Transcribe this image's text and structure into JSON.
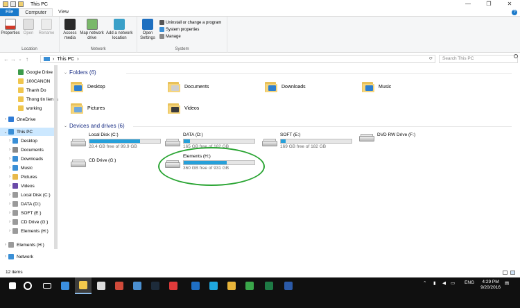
{
  "window": {
    "title": "This PC",
    "minimize": "—",
    "maximize": "❐",
    "close": "✕"
  },
  "ribbon": {
    "tabs": [
      "File",
      "Computer",
      "View"
    ],
    "help": "?",
    "groups": {
      "location": {
        "label": "Location",
        "buttons": [
          "Properties",
          "Open",
          "Rename"
        ]
      },
      "network": {
        "label": "Network",
        "buttons": [
          "Access media",
          "Map network drive",
          "Add a network location"
        ]
      },
      "system": {
        "label": "System",
        "open_settings": "Open Settings",
        "small": [
          "Uninstall or change a program",
          "System properties",
          "Manage"
        ]
      }
    }
  },
  "address": {
    "path_root": "This PC",
    "separator": "›",
    "search_placeholder": "Search This PC"
  },
  "nav": {
    "items": [
      {
        "label": "Google Drive",
        "color": "#3d9b4a",
        "expand": false
      },
      {
        "label": "100CANON",
        "color": "#f0c64e",
        "expand": false
      },
      {
        "label": "Thanh Do",
        "color": "#f0c64e",
        "expand": false
      },
      {
        "label": "Thong tin lien la",
        "color": "#f0c64e",
        "expand": false
      },
      {
        "label": "working",
        "color": "#f0c64e",
        "expand": false
      },
      {
        "label": "OneDrive",
        "color": "#2f7bd6",
        "expand": true
      },
      {
        "label": "This PC",
        "color": "#3a8fd6",
        "expand": true
      },
      {
        "label": "Desktop",
        "color": "#3a8fd6",
        "expand": true
      },
      {
        "label": "Documents",
        "color": "#8a8a8a",
        "expand": true
      },
      {
        "label": "Downloads",
        "color": "#3a8fd6",
        "expand": true
      },
      {
        "label": "Music",
        "color": "#3a8fd6",
        "expand": true
      },
      {
        "label": "Pictures",
        "color": "#e8b94a",
        "expand": true
      },
      {
        "label": "Videos",
        "color": "#6a4aa8",
        "expand": true
      },
      {
        "label": "Local Disk (C:)",
        "color": "#9a9a9a",
        "expand": true
      },
      {
        "label": "DATA (D:)",
        "color": "#9a9a9a",
        "expand": true
      },
      {
        "label": "SOFT (E:)",
        "color": "#9a9a9a",
        "expand": true
      },
      {
        "label": "CD Drive (G:)",
        "color": "#9a9a9a",
        "expand": true
      },
      {
        "label": "Elements (H:)",
        "color": "#9a9a9a",
        "expand": true
      },
      {
        "label": "Elements (H:)",
        "color": "#9a9a9a",
        "expand": true
      },
      {
        "label": "Network",
        "color": "#3a8fd6",
        "expand": true
      }
    ]
  },
  "folders": {
    "header": "Folders (6)",
    "items": [
      {
        "label": "Desktop",
        "accent": "#2d7fd0"
      },
      {
        "label": "Documents",
        "accent": "#cfcfcf"
      },
      {
        "label": "Downloads",
        "accent": "#2d7fd0"
      },
      {
        "label": "Music",
        "accent": "#2d7fd0"
      },
      {
        "label": "Pictures",
        "accent": "#6fa7dc"
      },
      {
        "label": "Videos",
        "accent": "#3b3b3b"
      }
    ]
  },
  "drives": {
    "header": "Devices and drives (6)",
    "items": [
      {
        "name": "Local Disk (C:)",
        "free": "28.4 GB free of 99.9 GB",
        "used_fraction": 0.72,
        "bar": true
      },
      {
        "name": "DATA (D:)",
        "free": "165 GB free of 182 GB",
        "used_fraction": 0.09,
        "bar": true
      },
      {
        "name": "SOFT (E:)",
        "free": "169 GB free of 182 GB",
        "used_fraction": 0.07,
        "bar": true
      },
      {
        "name": "DVD RW Drive (F:)",
        "free": "",
        "used_fraction": 0,
        "bar": false
      },
      {
        "name": "CD Drive (G:)",
        "free": "",
        "used_fraction": 0,
        "bar": false
      },
      {
        "name": "Elements (H:)",
        "free": "360 GB free of 931 GB",
        "used_fraction": 0.61,
        "bar": true
      }
    ]
  },
  "status": {
    "items_count": "12 items"
  },
  "taskbar": {
    "icons": [
      {
        "name": "start",
        "color": "#ffffff"
      },
      {
        "name": "cortana",
        "color": "#ffffff"
      },
      {
        "name": "task-view",
        "color": "#ffffff"
      },
      {
        "name": "edge",
        "color": "#3b8fe0"
      },
      {
        "name": "file-explorer",
        "color": "#f3c94c"
      },
      {
        "name": "store",
        "color": "#dcdcdc"
      },
      {
        "name": "app-a",
        "color": "#d04a3a"
      },
      {
        "name": "app-b",
        "color": "#4a8fd0"
      },
      {
        "name": "lightroom",
        "color": "#1d2b3a"
      },
      {
        "name": "app-c",
        "color": "#e03a3a"
      },
      {
        "name": "outlook",
        "color": "#1f6fc4"
      },
      {
        "name": "skype",
        "color": "#1fa8e0"
      },
      {
        "name": "chrome",
        "color": "#e8b43a"
      },
      {
        "name": "app-d",
        "color": "#3aa64a"
      },
      {
        "name": "excel",
        "color": "#1e7a45"
      },
      {
        "name": "word",
        "color": "#2b5aa8"
      }
    ],
    "lang": "ENG",
    "time": "4:29 PM",
    "date": "9/20/2016"
  },
  "colors": {
    "accent": "#1979ca",
    "highlight_ring": "#2ba534",
    "drive_bar": "#26a0da"
  }
}
